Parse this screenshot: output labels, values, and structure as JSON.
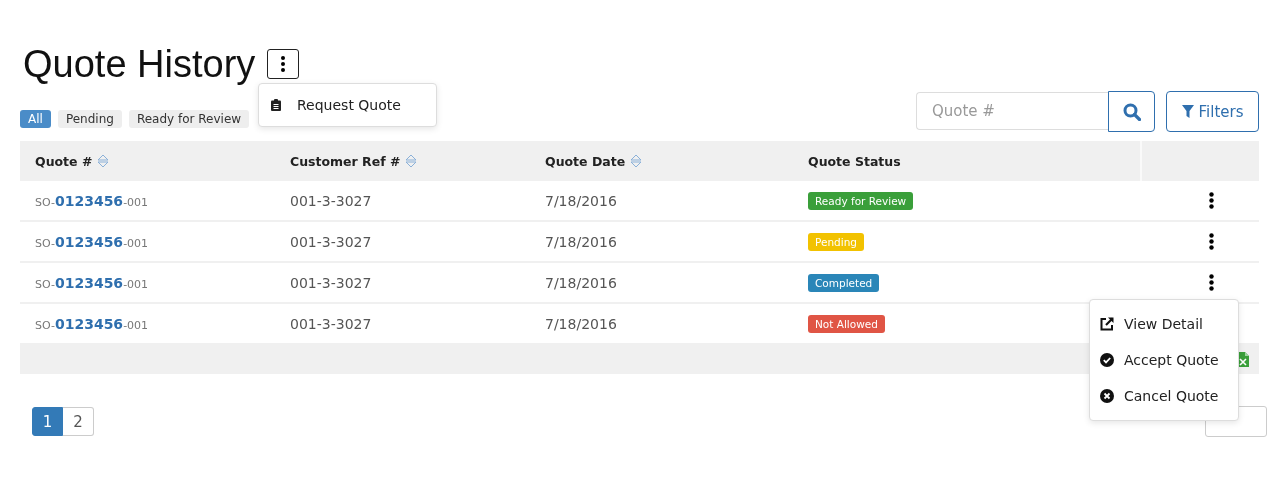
{
  "title": "Quote History",
  "title_menu": {
    "open": true,
    "items": [
      "Request Quote"
    ]
  },
  "filter_chips": [
    {
      "label": "All",
      "selected": true
    },
    {
      "label": "Pending",
      "selected": false
    },
    {
      "label": "Ready for Review",
      "selected": false
    }
  ],
  "search": {
    "placeholder": "Quote #"
  },
  "filters_button": "Filters",
  "table": {
    "columns": [
      {
        "label": "Quote #",
        "sortable": true
      },
      {
        "label": "Customer Ref #",
        "sortable": true
      },
      {
        "label": "Quote Date",
        "sortable": true
      },
      {
        "label": "Quote Status",
        "sortable": false
      }
    ],
    "rows": [
      {
        "prefix": "SO-",
        "number": "0123456",
        "suffix": "-001",
        "customer_ref": "001-3-3027",
        "date": "7/18/2016",
        "status": "Ready for Review",
        "color": "#3a9f3a",
        "actions_shown": true
      },
      {
        "prefix": "SO-",
        "number": "0123456",
        "suffix": "-001",
        "customer_ref": "001-3-3027",
        "date": "7/18/2016",
        "status": "Pending",
        "color": "#f2c200",
        "actions_shown": true
      },
      {
        "prefix": "SO-",
        "number": "0123456",
        "suffix": "-001",
        "customer_ref": "001-3-3027",
        "date": "7/18/2016",
        "status": "Completed",
        "color": "#2a86b8",
        "actions_shown": true
      },
      {
        "prefix": "SO-",
        "number": "0123456",
        "suffix": "-001",
        "customer_ref": "001-3-3027",
        "date": "7/18/2016",
        "status": "Not Allowed",
        "color": "#e05545",
        "actions_shown": false
      }
    ]
  },
  "row_menu": {
    "items": [
      {
        "kind": "open",
        "label": "View Detail"
      },
      {
        "kind": "accept",
        "label": "Accept Quote"
      },
      {
        "kind": "cancel",
        "label": "Cancel Quote"
      }
    ]
  },
  "pagination": [
    {
      "label": "1",
      "selected": true
    },
    {
      "label": "2",
      "selected": false
    }
  ]
}
